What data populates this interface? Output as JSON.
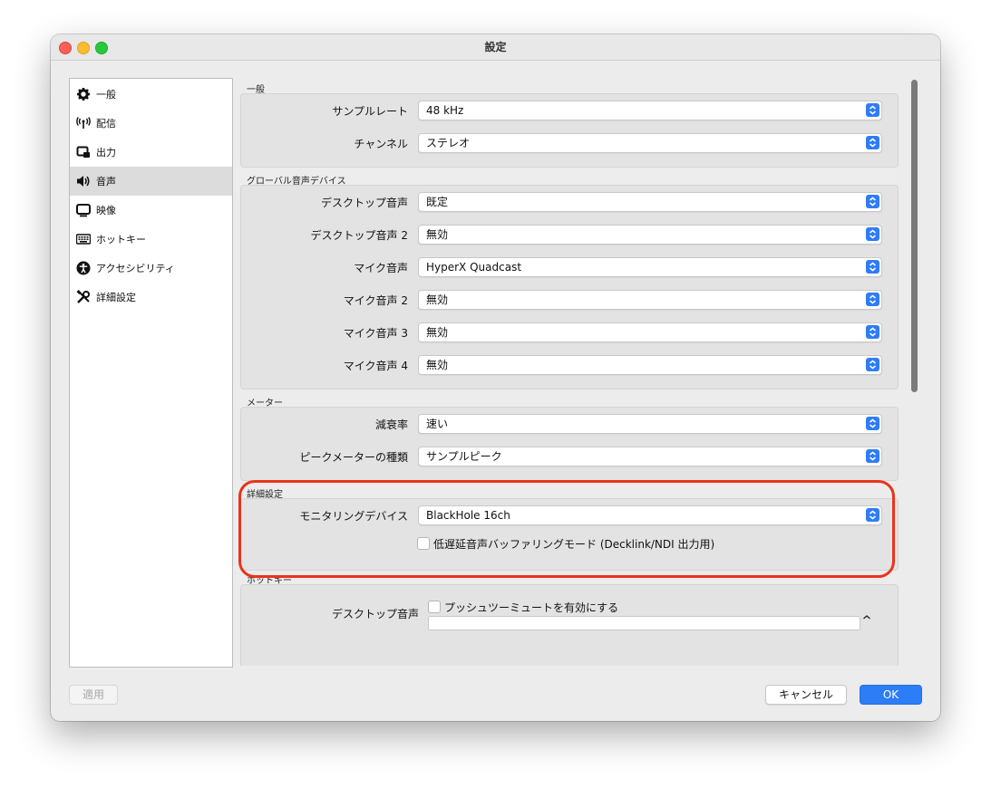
{
  "window": {
    "title": "設定"
  },
  "sidebar": {
    "items": [
      {
        "label": "一般",
        "icon": "gear-icon"
      },
      {
        "label": "配信",
        "icon": "antenna-icon"
      },
      {
        "label": "出力",
        "icon": "output-icon"
      },
      {
        "label": "音声",
        "icon": "speaker-icon",
        "active": true
      },
      {
        "label": "映像",
        "icon": "monitor-icon"
      },
      {
        "label": "ホットキー",
        "icon": "keyboard-icon"
      },
      {
        "label": "アクセシビリティ",
        "icon": "accessibility-icon"
      },
      {
        "label": "詳細設定",
        "icon": "tools-icon"
      }
    ]
  },
  "sections": {
    "general": {
      "title": "一般",
      "rows": [
        {
          "label": "サンプルレート",
          "value": "48 kHz"
        },
        {
          "label": "チャンネル",
          "value": "ステレオ"
        }
      ]
    },
    "global_audio": {
      "title": "グローバル音声デバイス",
      "rows": [
        {
          "label": "デスクトップ音声",
          "value": "既定"
        },
        {
          "label": "デスクトップ音声 2",
          "value": "無効"
        },
        {
          "label": "マイク音声",
          "value": "HyperX Quadcast"
        },
        {
          "label": "マイク音声 2",
          "value": "無効"
        },
        {
          "label": "マイク音声 3",
          "value": "無効"
        },
        {
          "label": "マイク音声 4",
          "value": "無効"
        }
      ]
    },
    "meter": {
      "title": "メーター",
      "rows": [
        {
          "label": "減衰率",
          "value": "速い"
        },
        {
          "label": "ピークメーターの種類",
          "value": "サンプルピーク"
        }
      ]
    },
    "advanced": {
      "title": "詳細設定",
      "rows": [
        {
          "label": "モニタリングデバイス",
          "value": "BlackHole 16ch"
        }
      ],
      "checkbox_label": "低遅延音声バッファリングモード (Decklink/NDI 出力用)"
    },
    "hotkeys": {
      "title": "ホットキー",
      "row_label": "デスクトップ音声",
      "checkbox_label": "プッシュツーミュートを有効にする"
    }
  },
  "buttons": {
    "apply": "適用",
    "cancel": "キャンセル",
    "ok": "OK"
  },
  "colors": {
    "accent": "#2c7df6",
    "highlight": "#e8341c"
  }
}
